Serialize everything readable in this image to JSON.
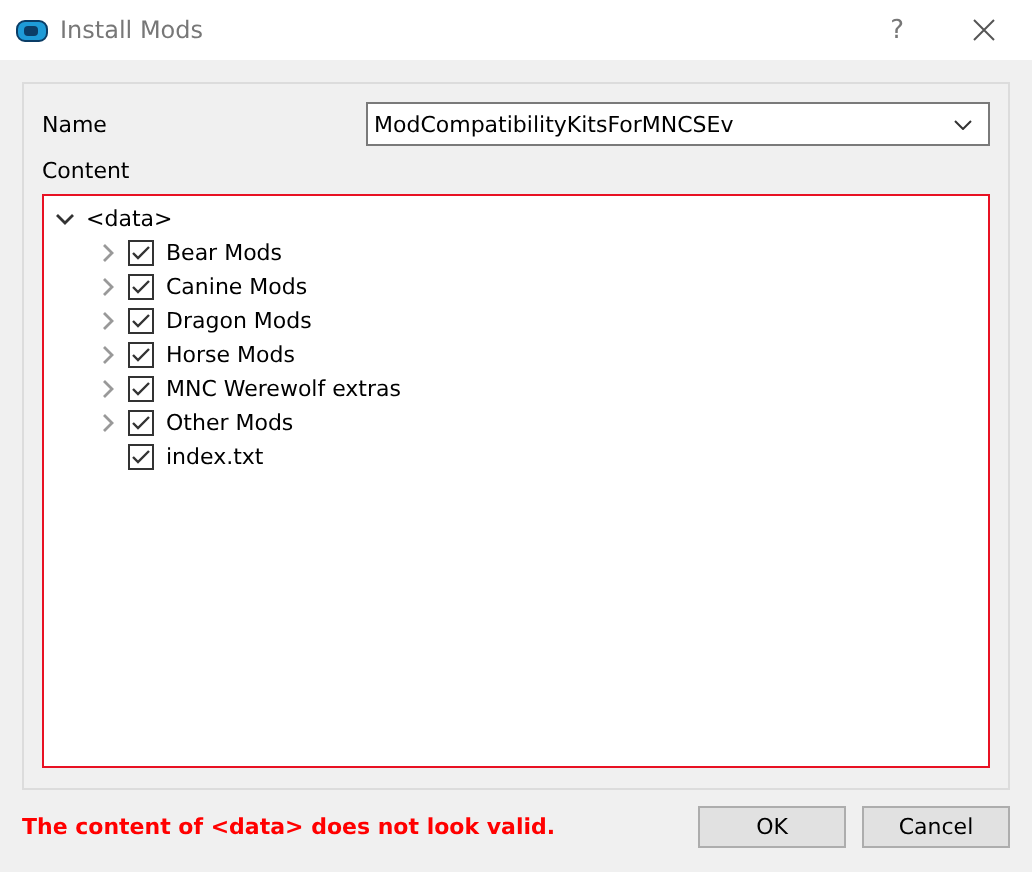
{
  "window": {
    "title": "Install Mods",
    "help": "?"
  },
  "name_field": {
    "label": "Name",
    "value": "ModCompatibilityKitsForMNCSEv"
  },
  "content": {
    "label": "Content",
    "invalid": true,
    "tree": [
      {
        "label": "<data>",
        "expanded": true,
        "children": [
          {
            "label": "Bear Mods",
            "checked": true,
            "has_children": true
          },
          {
            "label": "Canine Mods",
            "checked": true,
            "has_children": true
          },
          {
            "label": "Dragon Mods",
            "checked": true,
            "has_children": true
          },
          {
            "label": "Horse Mods",
            "checked": true,
            "has_children": true
          },
          {
            "label": "MNC Werewolf extras",
            "checked": true,
            "has_children": true
          },
          {
            "label": "Other Mods",
            "checked": true,
            "has_children": true
          },
          {
            "label": "index.txt",
            "checked": true,
            "has_children": false
          }
        ]
      }
    ]
  },
  "error": "The content of <data> does not look valid.",
  "buttons": [
    "OK",
    "Cancel"
  ]
}
